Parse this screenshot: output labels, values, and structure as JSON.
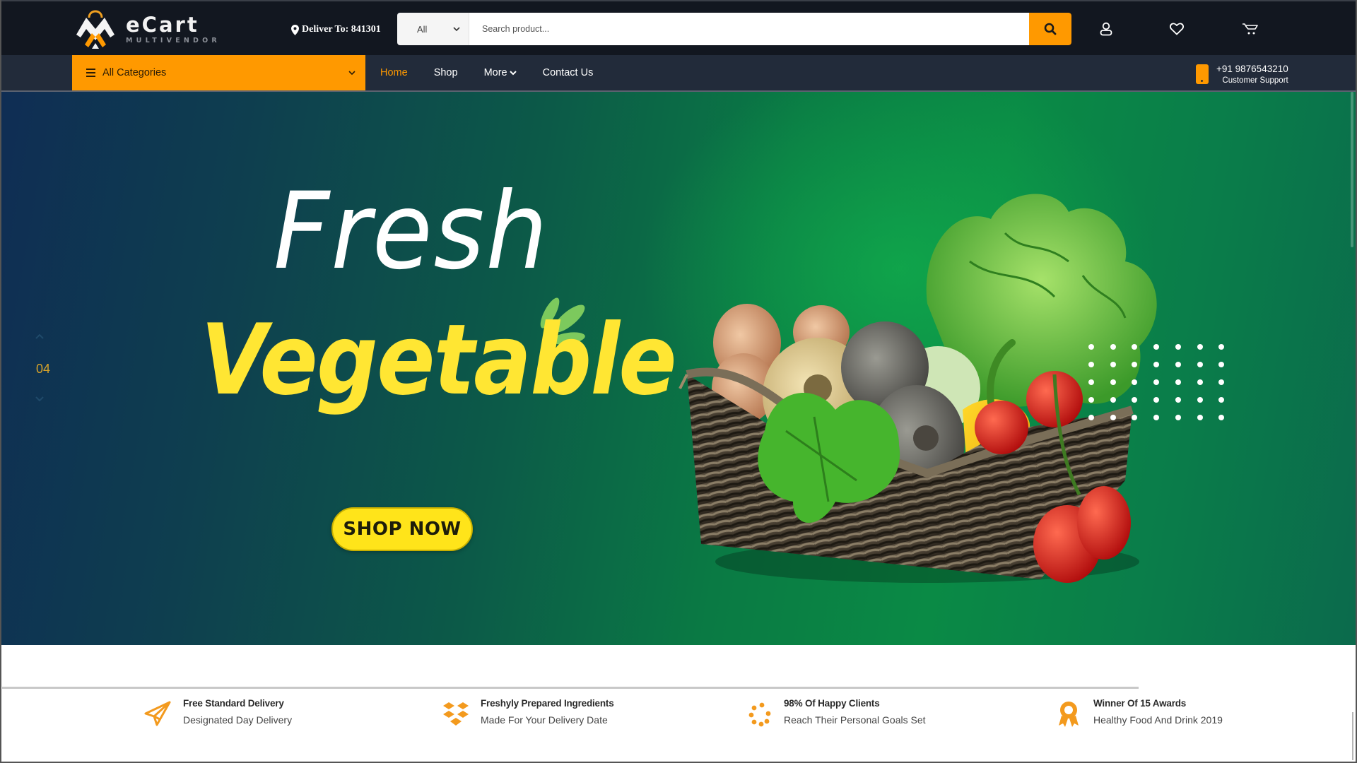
{
  "brand": {
    "name": "eCart",
    "tagline": "MULTIVENDOR",
    "accent_color": "#ff9900",
    "dark_bg": "#121720",
    "nav_bg": "#222b3a"
  },
  "header": {
    "deliver_label": "Deliver To: 841301",
    "search": {
      "category_value": "All",
      "placeholder": "Search product...",
      "value": ""
    },
    "icons": [
      "search-icon",
      "user-icon",
      "heart-icon",
      "cart-icon"
    ]
  },
  "nav": {
    "categories_label": "All Categories",
    "links": [
      {
        "label": "Home",
        "active": true
      },
      {
        "label": "Shop",
        "active": false
      },
      {
        "label": "More",
        "active": false,
        "has_dropdown": true
      },
      {
        "label": "Contact Us",
        "active": false
      }
    ],
    "support": {
      "phone": "+91 9876543210",
      "label": "Customer Support"
    }
  },
  "hero": {
    "slide_number": "04",
    "headline_line1": "Fresh",
    "headline_line2": "Vegetable",
    "cta_label": "SHOP NOW",
    "headline_color_1": "#ffffff",
    "headline_color_2": "#ffe633",
    "image_description": "wicker basket of fresh vegetables: onions, turnip, beets, yellow bell pepper, lettuce, tomatoes, mint"
  },
  "features": [
    {
      "icon": "paper-plane-icon",
      "title": "Free Standard Delivery",
      "subtitle": "Designated Day Delivery"
    },
    {
      "icon": "boxes-icon",
      "title": "Freshyly Prepared Ingredients",
      "subtitle": "Made For Your Delivery Date"
    },
    {
      "icon": "spinner-dots-icon",
      "title": "98% Of Happy Clients",
      "subtitle": "Reach Their Personal Goals Set"
    },
    {
      "icon": "award-icon",
      "title": "Winner Of 15 Awards",
      "subtitle": "Healthy Food And Drink 2019"
    }
  ]
}
